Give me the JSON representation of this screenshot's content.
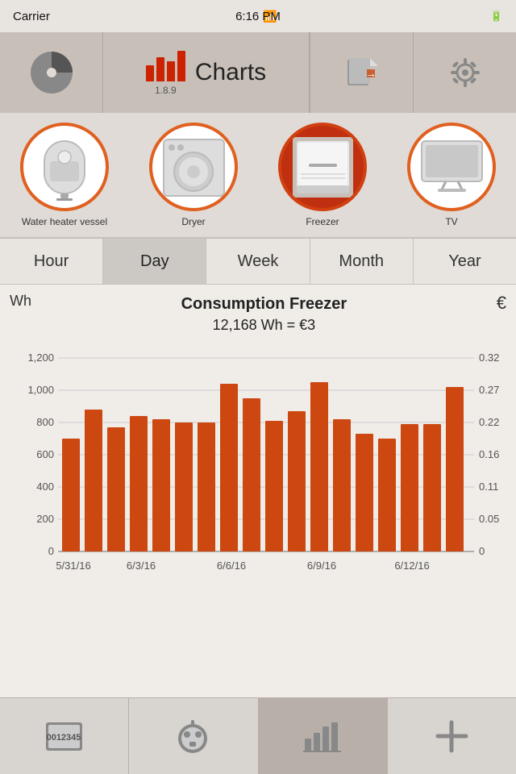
{
  "status_bar": {
    "carrier": "Carrier",
    "time": "6:16 PM",
    "battery": "▓▓▓▓▓"
  },
  "header": {
    "title": "Charts",
    "version": "1.8.9",
    "export_icon": "export-icon",
    "settings_icon": "gear-icon"
  },
  "devices": [
    {
      "id": "water-heater",
      "label": "Water heater vessel",
      "selected": false
    },
    {
      "id": "dryer",
      "label": "Dryer",
      "selected": false
    },
    {
      "id": "freezer",
      "label": "Freezer",
      "selected": true
    },
    {
      "id": "tv",
      "label": "TV",
      "selected": false
    }
  ],
  "tabs": [
    {
      "id": "hour",
      "label": "Hour",
      "active": false
    },
    {
      "id": "day",
      "label": "Day",
      "active": true
    },
    {
      "id": "week",
      "label": "Week",
      "active": false
    },
    {
      "id": "month",
      "label": "Month",
      "active": false
    },
    {
      "id": "year",
      "label": "Year",
      "active": false
    }
  ],
  "chart": {
    "y_label_left": "Wh",
    "y_label_right": "€",
    "title": "Consumption Freezer",
    "subtitle": "12,168 Wh = €3",
    "y_axis_left": [
      "1,200",
      "1,000",
      "800",
      "600",
      "400",
      "200",
      "0"
    ],
    "y_axis_right": [
      "0.32",
      "0.27",
      "0.22",
      "0.16",
      "0.11",
      "0.05",
      "0"
    ],
    "x_axis": [
      "5/31/16",
      "6/3/16",
      "6/6/16",
      "6/9/16",
      "6/12/16"
    ],
    "bars": [
      700,
      880,
      770,
      840,
      820,
      800,
      800,
      1040,
      950,
      810,
      870,
      1050,
      820,
      730,
      700,
      790,
      790,
      1020
    ],
    "bar_color": "#cc4810",
    "max_value": 1200
  },
  "bottom_toolbar": {
    "btn1_label": "device-list-icon",
    "btn2_label": "smart-plug-icon",
    "btn3_label": "bar-chart-icon",
    "btn4_label": "add-icon"
  }
}
